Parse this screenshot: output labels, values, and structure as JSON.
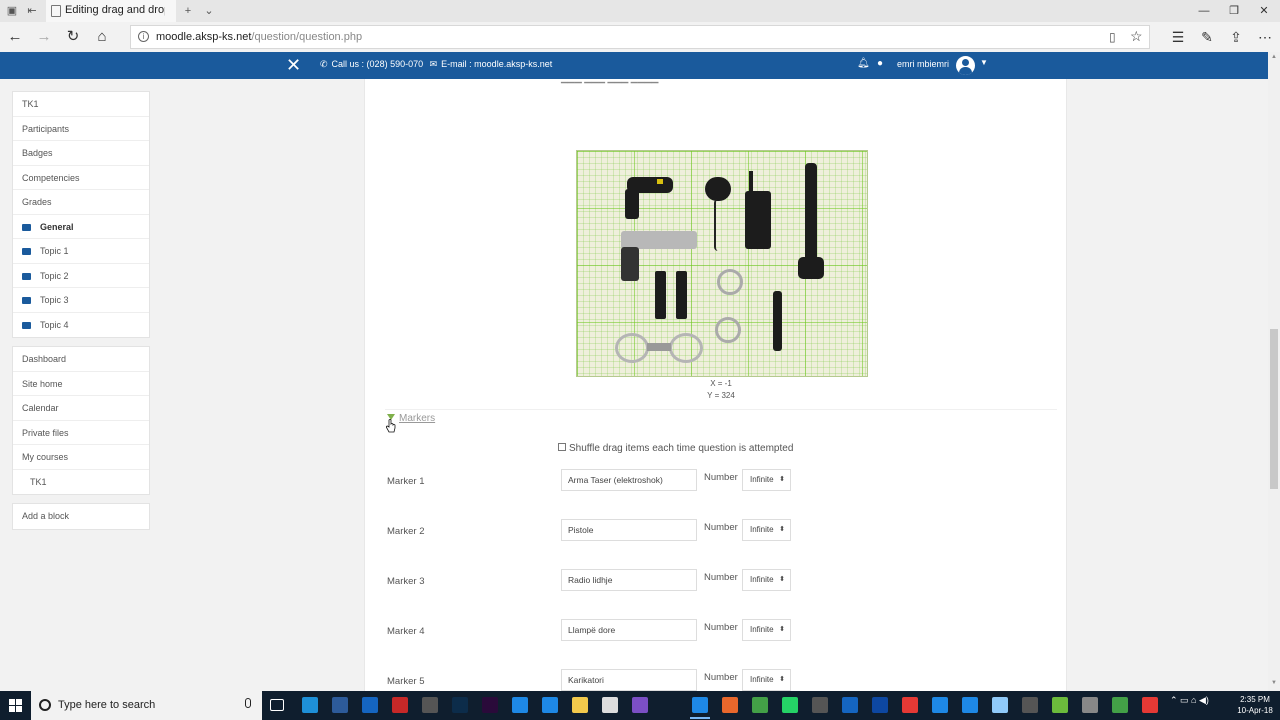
{
  "browser": {
    "tab_title": "Editing drag and drop m",
    "url_host": "moodle.aksp-ks.net",
    "url_path": "/question/question.php"
  },
  "header": {
    "contact_phone": "Call us : (028) 590-070",
    "contact_email": "E-mail : moodle.aksp-ks.net",
    "user_name": "emri mbiemri"
  },
  "sidebar": {
    "course_nav": [
      {
        "label": "TK1",
        "folder": false,
        "bold": false
      },
      {
        "label": "Participants",
        "folder": false,
        "bold": false
      },
      {
        "label": "Badges",
        "folder": false,
        "bold": false
      },
      {
        "label": "Competencies",
        "folder": false,
        "bold": false
      },
      {
        "label": "Grades",
        "folder": false,
        "bold": false
      },
      {
        "label": "General",
        "folder": true,
        "bold": true
      },
      {
        "label": "Topic 1",
        "folder": true,
        "bold": false
      },
      {
        "label": "Topic 2",
        "folder": true,
        "bold": false
      },
      {
        "label": "Topic 3",
        "folder": true,
        "bold": false
      },
      {
        "label": "Topic 4",
        "folder": true,
        "bold": false
      }
    ],
    "site_nav": [
      {
        "label": "Dashboard"
      },
      {
        "label": "Site home"
      },
      {
        "label": "Calendar"
      },
      {
        "label": "Private files"
      },
      {
        "label": "My courses"
      },
      {
        "label": "TK1",
        "indent": true
      }
    ],
    "add_block": "Add a block"
  },
  "main": {
    "coords": {
      "x": "X = -1",
      "y": "Y = 324"
    },
    "markers_section": "Markers",
    "shuffle_label": "Shuffle drag items each time question is attempted",
    "number_label": "Number",
    "markers": [
      {
        "label": "Marker 1",
        "value": "Arma Taser (elektroshok)",
        "number": "Infinite"
      },
      {
        "label": "Marker 2",
        "value": "Pistole",
        "number": "Infinite"
      },
      {
        "label": "Marker 3",
        "value": "Radio lidhje",
        "number": "Infinite"
      },
      {
        "label": "Marker 4",
        "value": "Llampë dore",
        "number": "Infinite"
      },
      {
        "label": "Marker 5",
        "value": "Karikatori",
        "number": "Infinite"
      }
    ]
  },
  "taskbar": {
    "search_placeholder": "Type here to search",
    "time": "2:35 PM",
    "date": "10-Apr-18"
  },
  "colors": {
    "brand": "#1a5a9c",
    "taskbar": "#0f1e2e"
  }
}
